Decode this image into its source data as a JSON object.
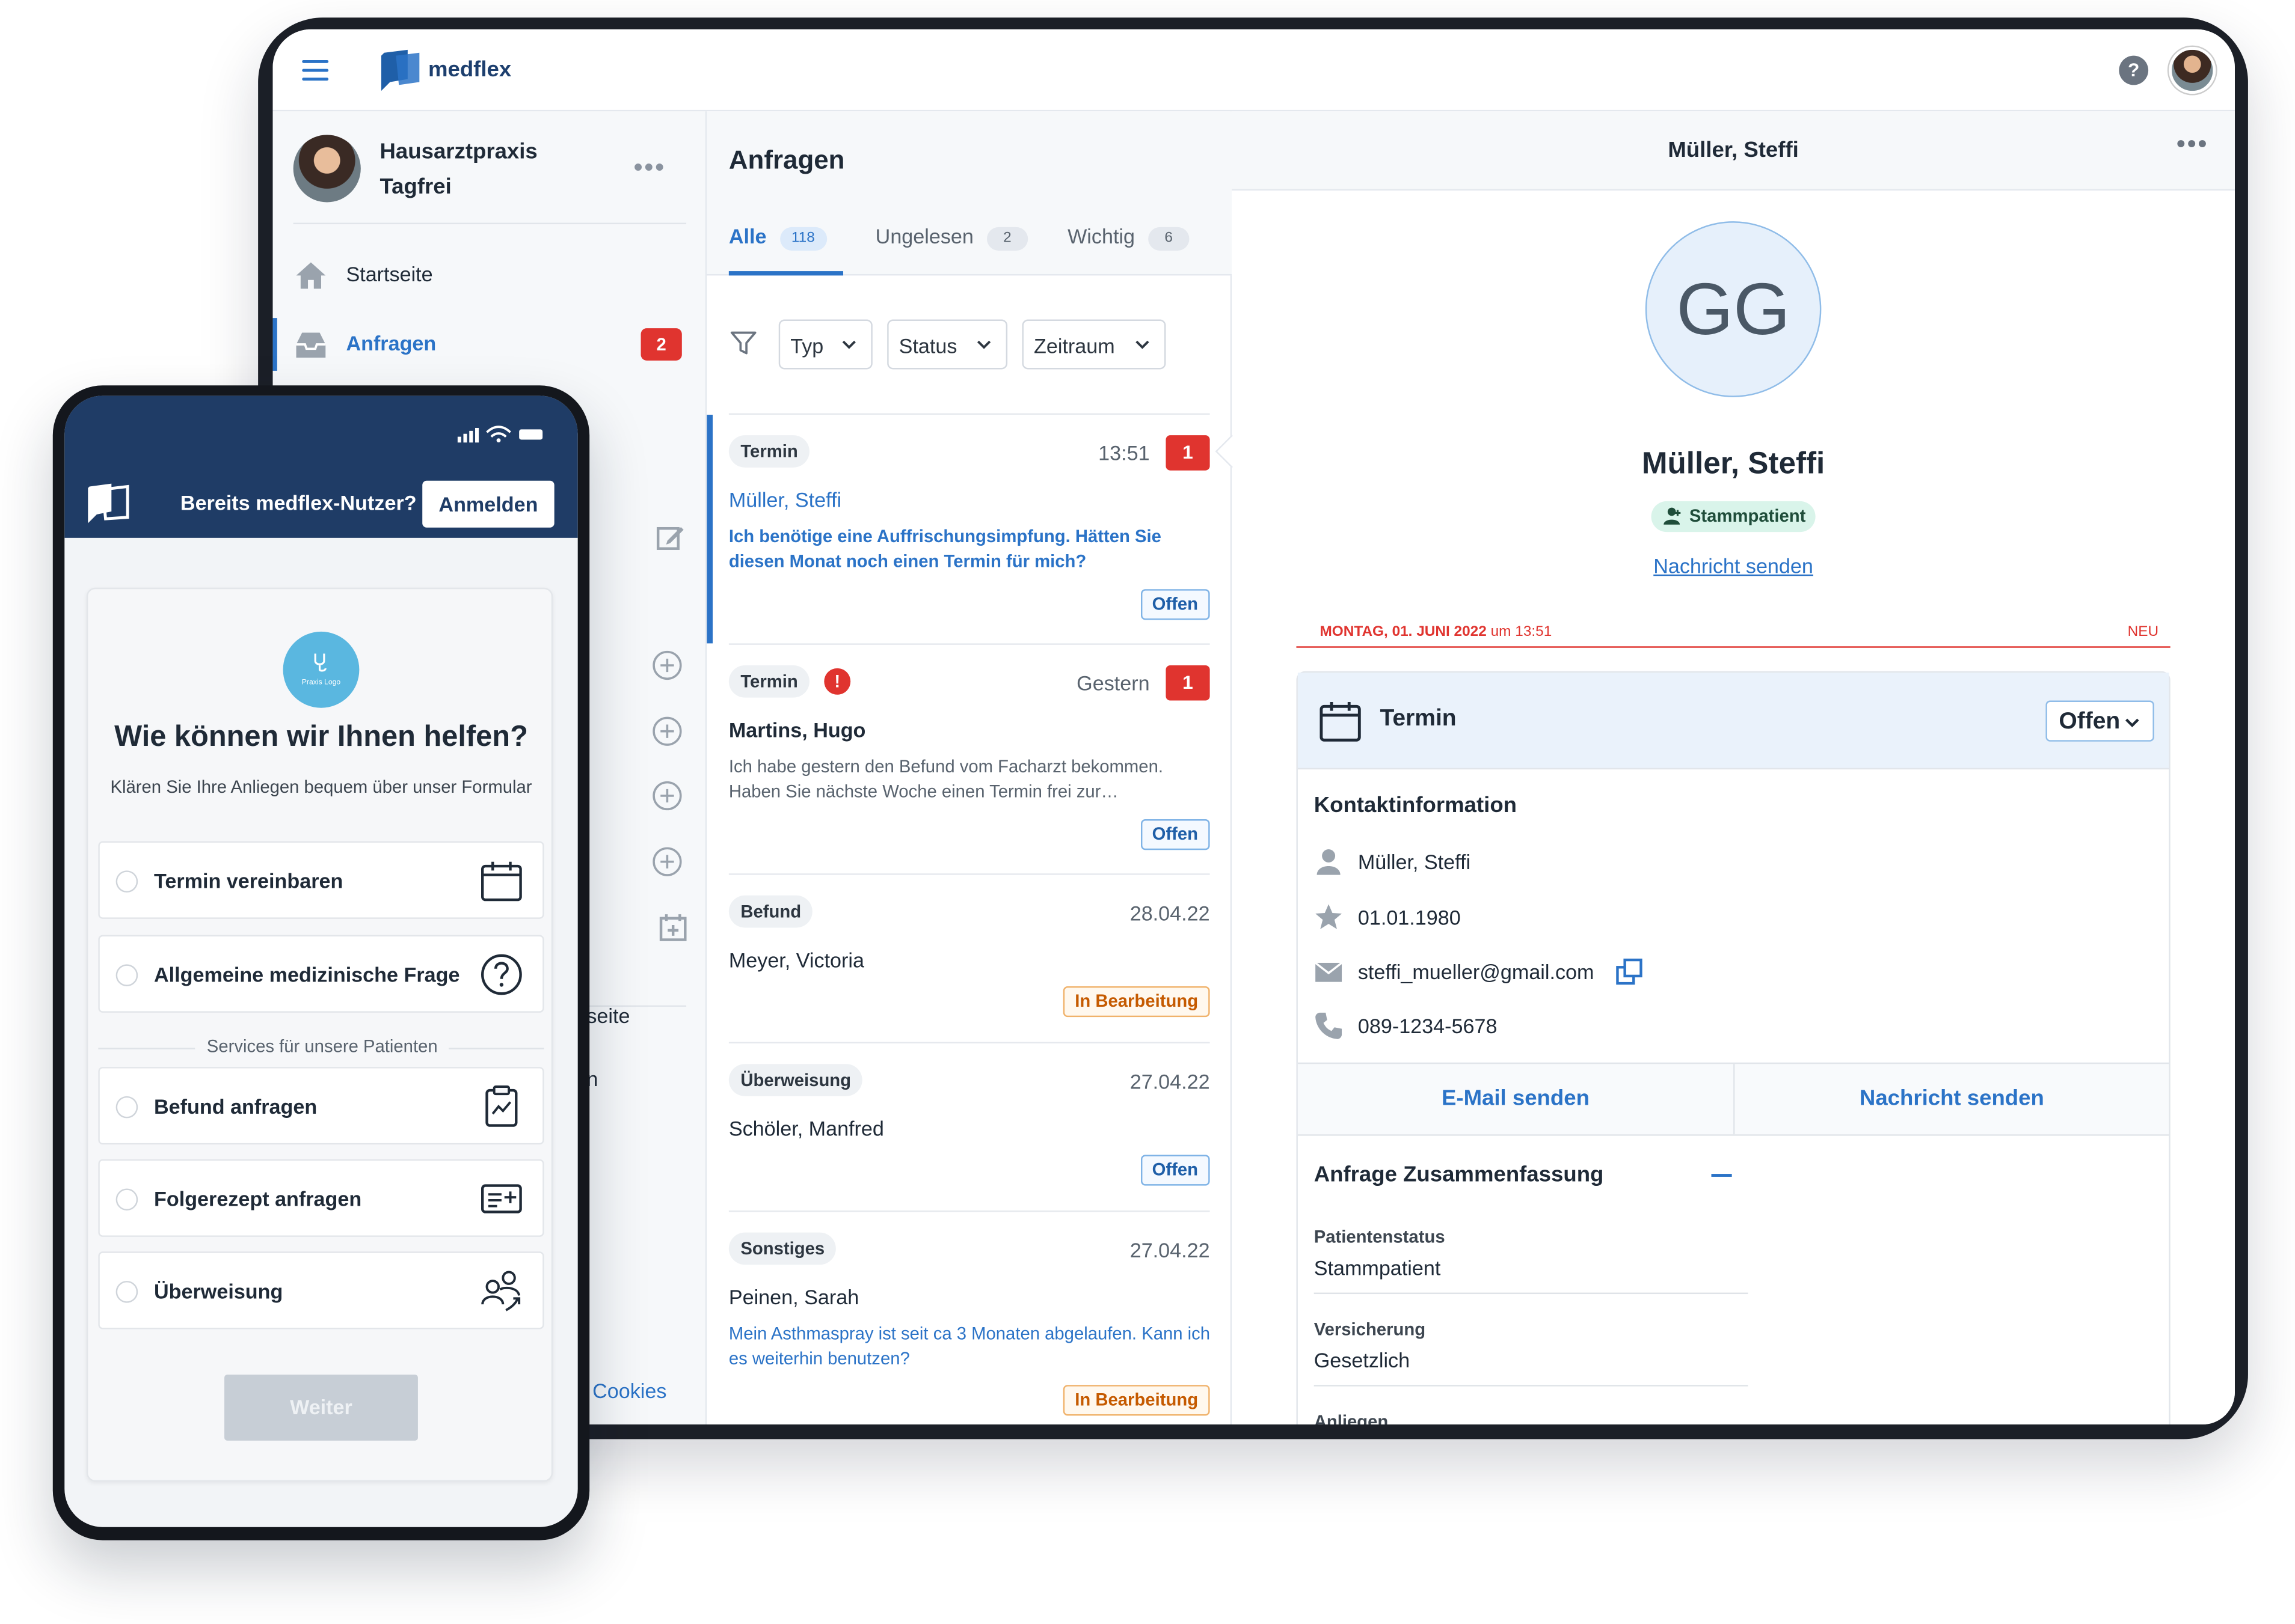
{
  "app": {
    "brand": "medflex",
    "help_symbol": "?"
  },
  "sidebar": {
    "org_name": "Hausarztpraxis Tagfrei",
    "more_symbol": "•••",
    "items": [
      {
        "label": "Startseite",
        "icon": "home-icon"
      },
      {
        "label": "Anfragen",
        "icon": "inbox-icon",
        "badge": "2"
      }
    ],
    "partial_texts": [
      "seite",
      "n"
    ],
    "cookies_label": "Cookies"
  },
  "inbox": {
    "title": "Anfragen",
    "tabs": [
      {
        "label": "Alle",
        "count": "118"
      },
      {
        "label": "Ungelesen",
        "count": "2"
      },
      {
        "label": "Wichtig",
        "count": "6"
      }
    ],
    "filters": [
      "Typ",
      "Status",
      "Zeitraum"
    ],
    "requests": [
      {
        "type": "Termin",
        "time": "13:51",
        "unread": "1",
        "name": "Müller, Steffi",
        "message": "Ich benötige eine Auffrischungsimpfung. Hätten Sie diesen Monat noch einen Termin für mich?",
        "status": "Offen"
      },
      {
        "type": "Termin",
        "alert": "!",
        "time": "Gestern",
        "unread": "1",
        "name": "Martins, Hugo",
        "message": "Ich habe gestern den Befund vom Facharzt bekommen. Haben Sie nächste Woche einen Termin frei zur…",
        "status": "Offen"
      },
      {
        "type": "Befund",
        "time": "28.04.22",
        "name": "Meyer, Victoria",
        "status": "In Bearbeitung"
      },
      {
        "type": "Überweisung",
        "time": "27.04.22",
        "name": "Schöler, Manfred",
        "status": "Offen"
      },
      {
        "type": "Sonstiges",
        "time": "27.04.22",
        "name": "Peinen, Sarah",
        "message": "Mein Asthmaspray ist seit  ca 3 Monaten abgelaufen. Kann ich es weiterhin benutzen?",
        "status": "In Bearbeitung"
      }
    ]
  },
  "detail": {
    "header_name": "Müller, Steffi",
    "more_symbol": "•••",
    "initials": "GG",
    "name": "Müller, Steffi",
    "badge": "Stammpatient",
    "message_link": "Nachricht senden",
    "date_label": "MONTAG, 01. JUNI 2022",
    "time_label": "um 13:51",
    "new_label": "NEU",
    "panel_title": "Termin",
    "panel_status": "Offen",
    "contact_title": "Kontaktinformation",
    "contact": {
      "name": "Müller, Steffi",
      "birthdate": "01.01.1980",
      "email": "steffi_mueller@gmail.com",
      "phone": "089-1234-5678"
    },
    "actions": {
      "email": "E-Mail senden",
      "message": "Nachricht senden"
    },
    "summary_title": "Anfrage Zusammenfassung",
    "summary": [
      {
        "label": "Patientenstatus",
        "value": "Stammpatient"
      },
      {
        "label": "Versicherung",
        "value": "Gesetzlich"
      },
      {
        "label": "Anliegen"
      }
    ]
  },
  "phone": {
    "question": "Bereits medflex-Nutzer?",
    "login": "Anmelden",
    "practice_logo_text": "Praxis Logo",
    "title": "Wie können wir Ihnen helfen?",
    "subtitle": "Klären Sie Ihre Anliegen bequem über unser Formular",
    "options_top": [
      {
        "label": "Termin vereinbaren",
        "icon": "calendar-icon"
      },
      {
        "label": "Allgemeine medizinische Frage",
        "icon": "question-icon"
      }
    ],
    "separator": "Services für unsere Patienten",
    "options_bottom": [
      {
        "label": "Befund anfragen",
        "icon": "clipboard-icon"
      },
      {
        "label": "Folgerezept anfragen",
        "icon": "prescription-icon"
      },
      {
        "label": "Überweisung",
        "icon": "referral-icon"
      }
    ],
    "button": "Weiter"
  },
  "colors": {
    "accent": "#2b73c7",
    "alert": "#e0342f",
    "phone_header": "#1f3c66",
    "stammpatient_bg": "#d9f4ea",
    "in_progress": "#c55a00"
  }
}
